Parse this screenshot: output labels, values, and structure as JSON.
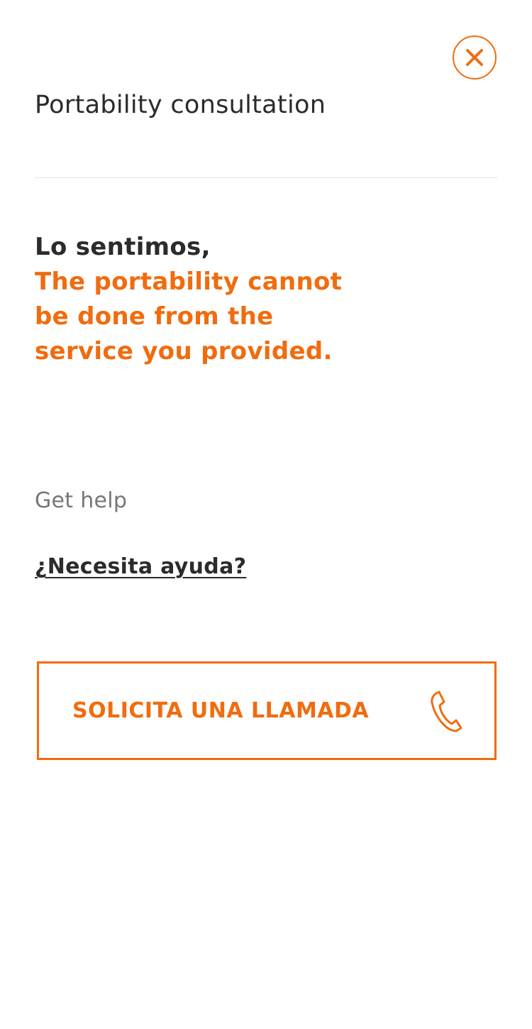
{
  "header": {
    "title": "Portability consultation",
    "close_icon": "close-icon"
  },
  "message": {
    "intro": "Lo sentimos,",
    "detail": "The portability cannot be done from the service you provided."
  },
  "help": {
    "section_label": "Get help",
    "link_label": "¿Necesita ayuda?"
  },
  "call_button": {
    "label": "SOLICITA UNA LLAMADA",
    "icon": "phone-icon"
  },
  "colors": {
    "accent": "#f06c0f",
    "text": "#2b2b2b",
    "muted": "#767676",
    "divider": "#e3e3e3"
  }
}
